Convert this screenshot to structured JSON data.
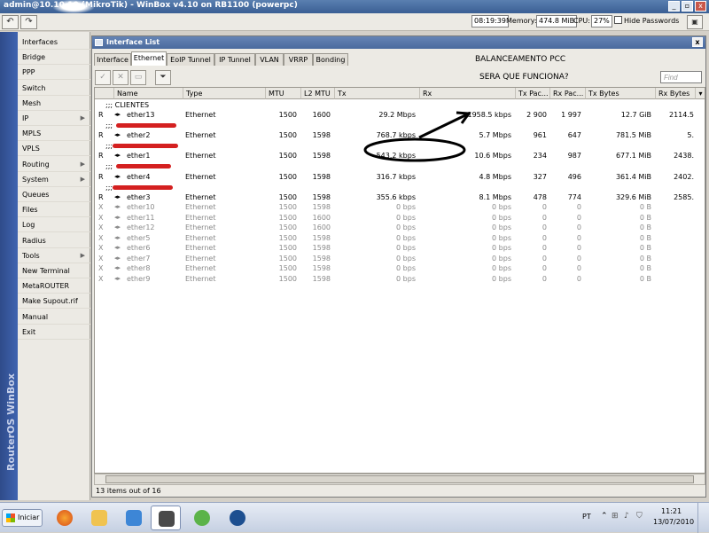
{
  "app": {
    "title": "admin@10.10.10 (MikroTik) - WinBox v4.10 on RB1100 (powerpc)",
    "window_buttons": [
      "_",
      "▫",
      "x"
    ]
  },
  "toolbar": {
    "time": "08:19:39",
    "memory_label": "Memory:",
    "memory_value": "474.8 MiB",
    "cpu_label": "CPU:",
    "cpu_value": "27%",
    "hide_passwords": "Hide Passwords"
  },
  "sidebar": {
    "brand": "RouterOS WinBox",
    "items": [
      {
        "label": "Interfaces",
        "arrow": ""
      },
      {
        "label": "Bridge",
        "arrow": ""
      },
      {
        "label": "PPP",
        "arrow": ""
      },
      {
        "label": "Switch",
        "arrow": ""
      },
      {
        "label": "Mesh",
        "arrow": ""
      },
      {
        "label": "IP",
        "arrow": "▶"
      },
      {
        "label": "MPLS",
        "arrow": ""
      },
      {
        "label": "VPLS",
        "arrow": ""
      },
      {
        "label": "Routing",
        "arrow": "▶"
      },
      {
        "label": "System",
        "arrow": "▶"
      },
      {
        "label": "Queues",
        "arrow": ""
      },
      {
        "label": "Files",
        "arrow": ""
      },
      {
        "label": "Log",
        "arrow": ""
      },
      {
        "label": "Radius",
        "arrow": ""
      },
      {
        "label": "Tools",
        "arrow": "▶"
      },
      {
        "label": "New Terminal",
        "arrow": ""
      },
      {
        "label": "MetaROUTER",
        "arrow": ""
      },
      {
        "label": "Make Supout.rif",
        "arrow": ""
      },
      {
        "label": "Manual",
        "arrow": ""
      },
      {
        "label": "Exit",
        "arrow": ""
      }
    ]
  },
  "window": {
    "title": "Interface List",
    "close": "x",
    "tabs": [
      "Interface",
      "Ethernet",
      "EoIP Tunnel",
      "IP Tunnel",
      "VLAN",
      "VRRP",
      "Bonding"
    ],
    "active_tab": "Ethernet",
    "find_placeholder": "Find",
    "annotation1": "BALANCEAMENTO PCC",
    "annotation2": "SERA QUE FUNCIONA?",
    "columns": [
      "",
      "Name",
      "Type",
      "MTU",
      "L2 MTU",
      "Tx",
      "Rx",
      "Tx Pac...",
      "Rx Pac...",
      "Tx Bytes",
      "Rx Bytes"
    ],
    "groups": [
      {
        "label": ";;; CLIENTES"
      },
      {
        "label": ";;; "
      },
      {
        "label": ";;; "
      },
      {
        "label": ";;; "
      },
      {
        "label": ";;; "
      }
    ],
    "rows": [
      {
        "flag": "R",
        "name": "ether13",
        "type": "Ethernet",
        "mtu": "1500",
        "l2mtu": "1600",
        "tx": "29.2 Mbps",
        "rx": "1958.5 kbps",
        "txp": "2 900",
        "rxp": "1 997",
        "txb": "12.7 GiB",
        "rxb": "2114.5"
      },
      {
        "flag": "R",
        "name": "ether2",
        "type": "Ethernet",
        "mtu": "1500",
        "l2mtu": "1598",
        "tx": "768.7 kbps",
        "rx": "5.7 Mbps",
        "txp": "961",
        "rxp": "647",
        "txb": "781.5 MiB",
        "rxb": "5."
      },
      {
        "flag": "R",
        "name": "ether1",
        "type": "Ethernet",
        "mtu": "1500",
        "l2mtu": "1598",
        "tx": "543.2 kbps",
        "rx": "10.6 Mbps",
        "txp": "234",
        "rxp": "987",
        "txb": "677.1 MiB",
        "rxb": "2438."
      },
      {
        "flag": "R",
        "name": "ether4",
        "type": "Ethernet",
        "mtu": "1500",
        "l2mtu": "1598",
        "tx": "316.7 kbps",
        "rx": "4.8 Mbps",
        "txp": "327",
        "rxp": "496",
        "txb": "361.4 MiB",
        "rxb": "2402."
      },
      {
        "flag": "R",
        "name": "ether3",
        "type": "Ethernet",
        "mtu": "1500",
        "l2mtu": "1598",
        "tx": "355.6 kbps",
        "rx": "8.1 Mbps",
        "txp": "478",
        "rxp": "774",
        "txb": "329.6 MiB",
        "rxb": "2585."
      },
      {
        "flag": "X",
        "name": "ether10",
        "type": "Ethernet",
        "mtu": "1500",
        "l2mtu": "1598",
        "tx": "0 bps",
        "rx": "0 bps",
        "txp": "0",
        "rxp": "0",
        "txb": "0 B",
        "rxb": ""
      },
      {
        "flag": "X",
        "name": "ether11",
        "type": "Ethernet",
        "mtu": "1500",
        "l2mtu": "1600",
        "tx": "0 bps",
        "rx": "0 bps",
        "txp": "0",
        "rxp": "0",
        "txb": "0 B",
        "rxb": ""
      },
      {
        "flag": "X",
        "name": "ether12",
        "type": "Ethernet",
        "mtu": "1500",
        "l2mtu": "1600",
        "tx": "0 bps",
        "rx": "0 bps",
        "txp": "0",
        "rxp": "0",
        "txb": "0 B",
        "rxb": ""
      },
      {
        "flag": "X",
        "name": "ether5",
        "type": "Ethernet",
        "mtu": "1500",
        "l2mtu": "1598",
        "tx": "0 bps",
        "rx": "0 bps",
        "txp": "0",
        "rxp": "0",
        "txb": "0 B",
        "rxb": ""
      },
      {
        "flag": "X",
        "name": "ether6",
        "type": "Ethernet",
        "mtu": "1500",
        "l2mtu": "1598",
        "tx": "0 bps",
        "rx": "0 bps",
        "txp": "0",
        "rxp": "0",
        "txb": "0 B",
        "rxb": ""
      },
      {
        "flag": "X",
        "name": "ether7",
        "type": "Ethernet",
        "mtu": "1500",
        "l2mtu": "1598",
        "tx": "0 bps",
        "rx": "0 bps",
        "txp": "0",
        "rxp": "0",
        "txb": "0 B",
        "rxb": ""
      },
      {
        "flag": "X",
        "name": "ether8",
        "type": "Ethernet",
        "mtu": "1500",
        "l2mtu": "1598",
        "tx": "0 bps",
        "rx": "0 bps",
        "txp": "0",
        "rxp": "0",
        "txb": "0 B",
        "rxb": ""
      },
      {
        "flag": "X",
        "name": "ether9",
        "type": "Ethernet",
        "mtu": "1500",
        "l2mtu": "1598",
        "tx": "0 bps",
        "rx": "0 bps",
        "txp": "0",
        "rxp": "0",
        "txb": "0 B",
        "rxb": ""
      }
    ],
    "status": "13 items out of 16"
  },
  "taskbar": {
    "start": "Iniciar",
    "lang": "PT",
    "time": "11:21",
    "date": "13/07/2010"
  },
  "colors": {
    "accent": "#3a5f94",
    "redaction": "#d42020",
    "highlight_circle": "#000000"
  }
}
